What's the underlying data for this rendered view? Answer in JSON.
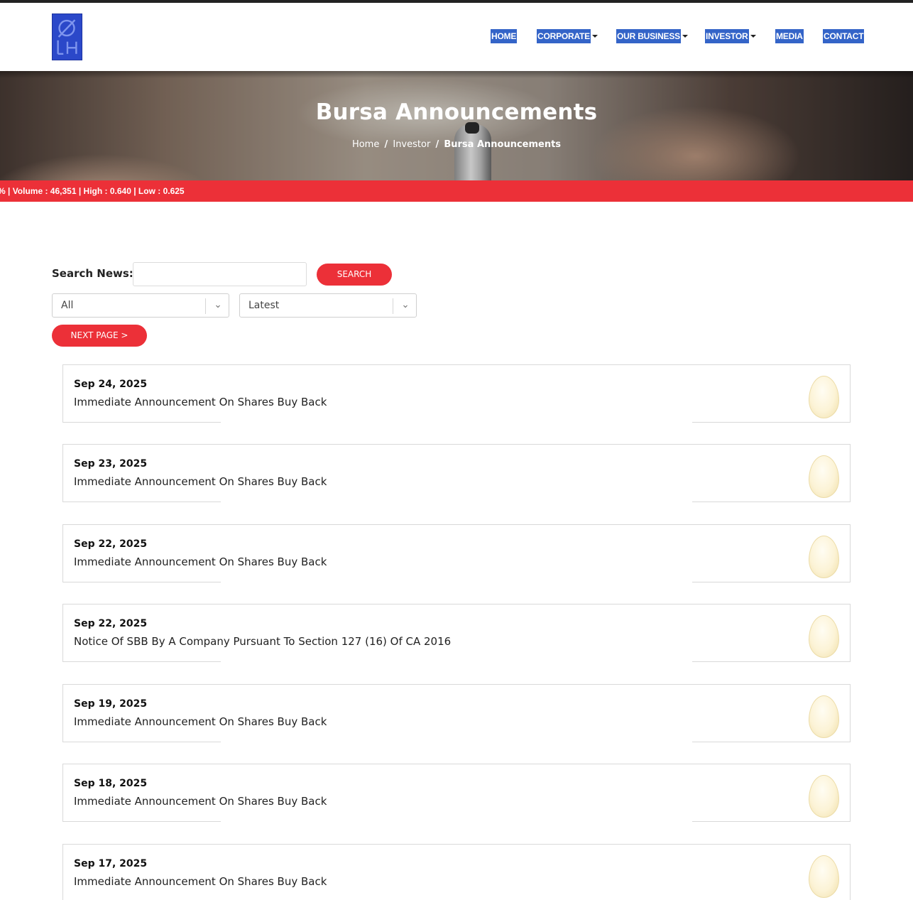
{
  "nav": {
    "items": [
      {
        "label": "HOME",
        "dropdown": false
      },
      {
        "label": "CORPORATE",
        "dropdown": true
      },
      {
        "label": "OUR BUSINESS",
        "dropdown": true
      },
      {
        "label": "INVESTOR",
        "dropdown": true
      },
      {
        "label": "MEDIA",
        "dropdown": false
      },
      {
        "label": "CONTACT",
        "dropdown": false
      }
    ]
  },
  "hero": {
    "title": "Bursa Announcements",
    "breadcrumb": {
      "home": "Home",
      "separator": "/",
      "parent": "Investor",
      "current": "Bursa Announcements"
    }
  },
  "ticker": {
    "text": "%  |  Volume : 46,351   |  High : 0.640  |  Low : 0.625"
  },
  "search": {
    "label": "Search News:",
    "value": "",
    "button": "SEARCH"
  },
  "filters": {
    "category": {
      "selected": "All"
    },
    "sort": {
      "selected": "Latest"
    }
  },
  "pagination": {
    "next_label": "NEXT PAGE >"
  },
  "news": [
    {
      "date": "Sep 24, 2025",
      "title": "Immediate Announcement On Shares Buy Back"
    },
    {
      "date": "Sep 23, 2025",
      "title": "Immediate Announcement On Shares Buy Back"
    },
    {
      "date": "Sep 22, 2025",
      "title": "Immediate Announcement On Shares Buy Back"
    },
    {
      "date": "Sep 22, 2025",
      "title": "Notice Of SBB By A Company Pursuant To Section 127 (16) Of CA 2016"
    },
    {
      "date": "Sep 19, 2025",
      "title": "Immediate Announcement On Shares Buy Back"
    },
    {
      "date": "Sep 18, 2025",
      "title": "Immediate Announcement On Shares Buy Back"
    },
    {
      "date": "Sep 17, 2025",
      "title": "Immediate Announcement On Shares Buy Back"
    }
  ],
  "colors": {
    "accent": "#ec3038",
    "nav_highlight": "#3464c8",
    "logo": "#2b48c9"
  }
}
